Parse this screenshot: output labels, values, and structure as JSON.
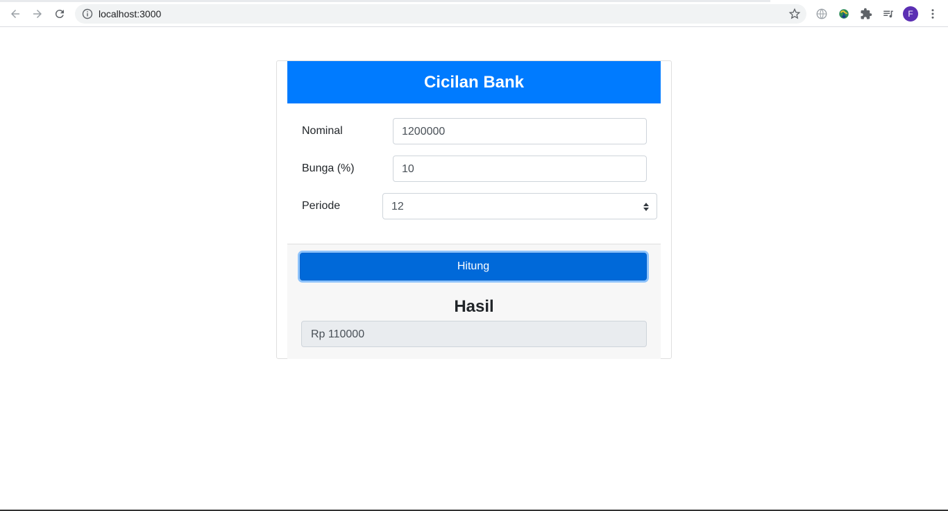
{
  "browser": {
    "url": "localhost:3000",
    "profile_initial": "F"
  },
  "card": {
    "title": "Cicilan Bank",
    "fields": {
      "nominal": {
        "label": "Nominal",
        "value": "1200000"
      },
      "bunga": {
        "label": "Bunga (%)",
        "value": "10"
      },
      "periode": {
        "label": "Periode",
        "value": "12"
      }
    },
    "button_label": "Hitung",
    "result_title": "Hasil",
    "result_value": "Rp 110000"
  },
  "colors": {
    "header": "#007bff",
    "button": "#0069d9",
    "avatar": "#5b2fb3"
  }
}
